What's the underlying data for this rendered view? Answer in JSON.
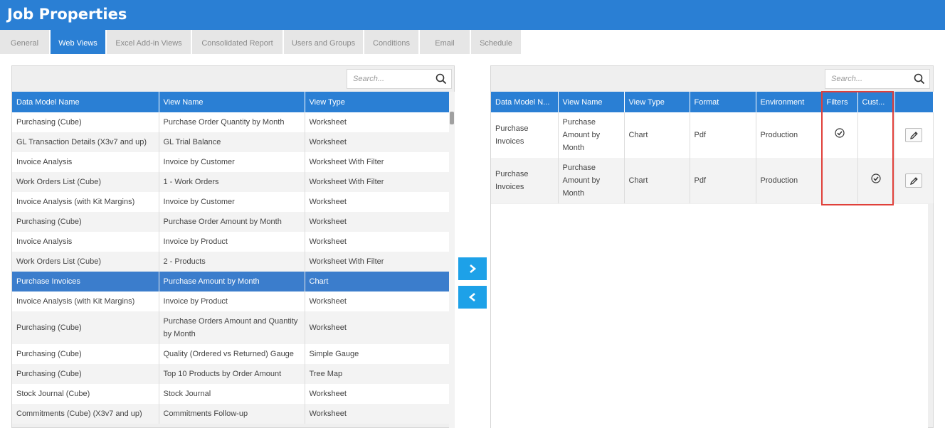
{
  "window": {
    "title": "Job Properties"
  },
  "tabs": [
    {
      "label": "General",
      "active": false
    },
    {
      "label": "Web Views",
      "active": true
    },
    {
      "label": "Excel Add-in Views",
      "active": false
    },
    {
      "label": "Consolidated Report",
      "active": false
    },
    {
      "label": "Users and Groups",
      "active": false
    },
    {
      "label": "Conditions",
      "active": false
    },
    {
      "label": "Email",
      "active": false
    },
    {
      "label": "Schedule",
      "active": false
    }
  ],
  "left": {
    "search_placeholder": "Search...",
    "columns": [
      "Data Model Name",
      "View Name",
      "View Type"
    ],
    "rows": [
      {
        "model": "Purchasing (Cube)",
        "view": "Purchase Order Quantity by Month",
        "type": "Worksheet"
      },
      {
        "model": "GL Transaction Details (X3v7 and up)",
        "view": "GL Trial Balance",
        "type": "Worksheet"
      },
      {
        "model": "Invoice Analysis",
        "view": "Invoice by Customer",
        "type": "Worksheet With Filter"
      },
      {
        "model": "Work Orders List (Cube)",
        "view": "1 - Work Orders",
        "type": "Worksheet With Filter"
      },
      {
        "model": "Invoice Analysis (with Kit Margins)",
        "view": "Invoice by Customer",
        "type": "Worksheet"
      },
      {
        "model": "Purchasing (Cube)",
        "view": "Purchase Order Amount by Month",
        "type": "Worksheet"
      },
      {
        "model": "Invoice Analysis",
        "view": "Invoice by Product",
        "type": "Worksheet"
      },
      {
        "model": "Work Orders List (Cube)",
        "view": "2 - Products",
        "type": "Worksheet With Filter"
      },
      {
        "model": "Purchase Invoices",
        "view": "Purchase Amount by Month",
        "type": "Chart",
        "selected": true
      },
      {
        "model": "Invoice Analysis (with Kit Margins)",
        "view": "Invoice by Product",
        "type": "Worksheet"
      },
      {
        "model": "Purchasing (Cube)",
        "view": "Purchase Orders Amount and Quantity by Month",
        "type": "Worksheet"
      },
      {
        "model": "Purchasing (Cube)",
        "view": "Quality (Ordered vs Returned) Gauge",
        "type": "Simple Gauge"
      },
      {
        "model": "Purchasing (Cube)",
        "view": "Top 10 Products by Order Amount",
        "type": "Tree Map"
      },
      {
        "model": "Stock Journal (Cube)",
        "view": "Stock Journal",
        "type": "Worksheet"
      },
      {
        "model": "Commitments (Cube) (X3v7 and up)",
        "view": "Commitments Follow-up",
        "type": "Worksheet"
      }
    ]
  },
  "right": {
    "search_placeholder": "Search...",
    "columns": [
      "Data Model N...",
      "View Name",
      "View Type",
      "Format",
      "Environment",
      "Filters",
      "Cust..."
    ],
    "rows": [
      {
        "model": "Purchase Invoices",
        "view": "Purchase Amount by Month",
        "type": "Chart",
        "format": "Pdf",
        "environment": "Production",
        "filters": true,
        "custom": false
      },
      {
        "model": "Purchase Invoices",
        "view": "Purchase Amount by Month",
        "type": "Chart",
        "format": "Pdf",
        "environment": "Production",
        "filters": false,
        "custom": true
      }
    ]
  },
  "colors": {
    "accent": "#2a7fd4",
    "move_button": "#1da1e8",
    "highlight": "#e0403a",
    "selected_row": "#3b7dcc"
  },
  "icons": {
    "search": "search-icon",
    "move_right": "chevron-right-icon",
    "move_left": "chevron-left-icon",
    "check": "check-circle-icon",
    "edit": "pencil-icon"
  }
}
